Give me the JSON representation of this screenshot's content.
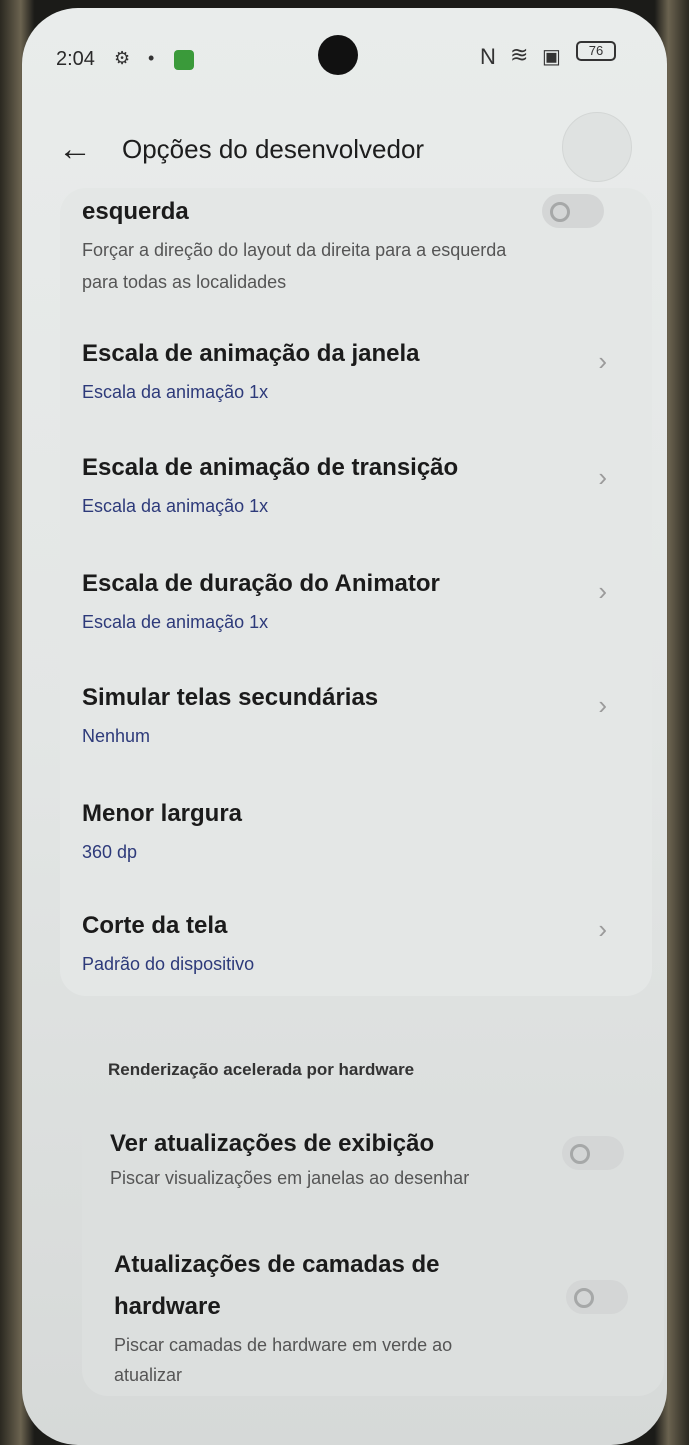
{
  "status": {
    "time": "2:04",
    "battery": "76"
  },
  "header": {
    "title": "Opções do desenvolvedor"
  },
  "top_partial": {
    "title": "esquerda",
    "description": "Forçar a direção do layout da direita para a esquerda para todas as localidades"
  },
  "settings": [
    {
      "title": "Escala de animação da janela",
      "value": "Escala da animação 1x"
    },
    {
      "title": "Escala de animação de transição",
      "value": "Escala da animação 1x"
    },
    {
      "title": "Escala de duração do Animator",
      "value": "Escala de animação 1x"
    },
    {
      "title": "Simular telas secundárias",
      "value": "Nenhum"
    },
    {
      "title": "Menor largura",
      "value": "360 dp"
    },
    {
      "title": "Corte da tela",
      "value": "Padrão do dispositivo"
    }
  ],
  "hardware_section": {
    "heading": "Renderização acelerada por hardware",
    "items": [
      {
        "title": "Ver atualizações de exibição",
        "description": "Piscar visualizações em janelas ao desenhar"
      },
      {
        "title": "Atualizações de camadas de hardware",
        "description": "Piscar camadas de hardware em verde ao atualizar"
      }
    ]
  }
}
